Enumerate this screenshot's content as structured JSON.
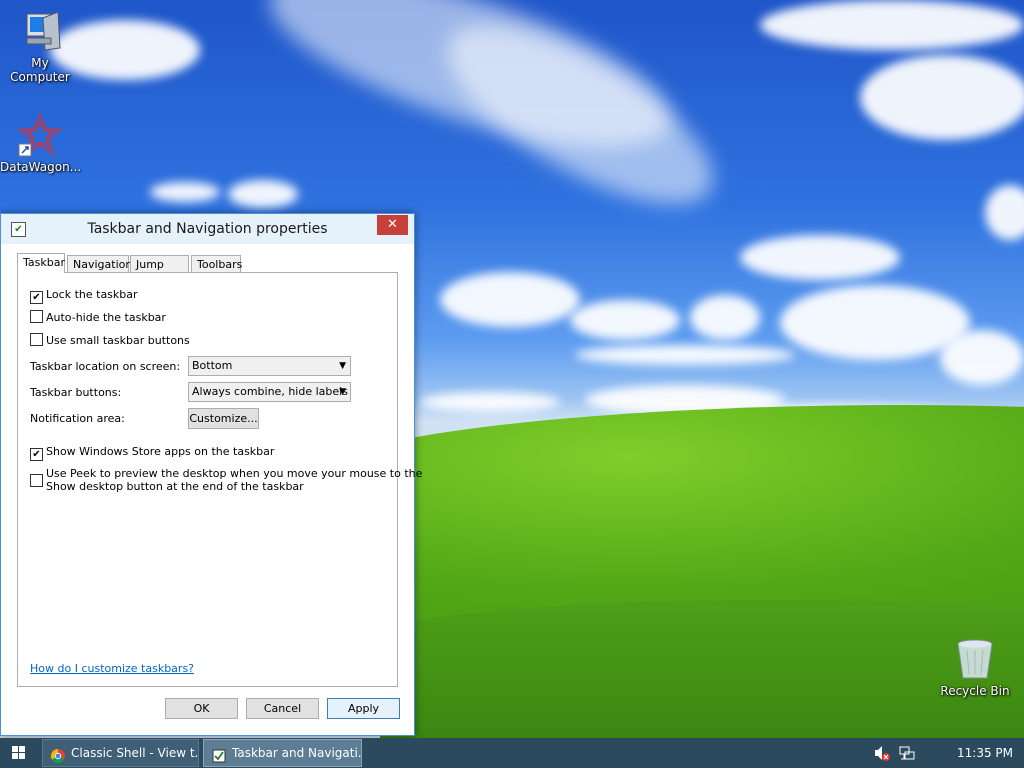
{
  "desktop": {
    "icons": [
      {
        "label": "My Computer",
        "icon": "computer-icon"
      },
      {
        "label": "DataWagon...",
        "icon": "datawagon-icon"
      },
      {
        "label": "Recycle Bin",
        "icon": "recycle-bin-icon"
      }
    ]
  },
  "dialog": {
    "title": "Taskbar and Navigation properties",
    "close_glyph": "✕",
    "tabs": [
      "Taskbar",
      "Navigation",
      "Jump Lists",
      "Toolbars"
    ],
    "active_tab": "Taskbar",
    "options": [
      {
        "label": "Lock the taskbar",
        "checked": true
      },
      {
        "label": "Auto-hide the taskbar",
        "checked": false
      },
      {
        "label": "Use small taskbar buttons",
        "checked": false
      }
    ],
    "location_label": "Taskbar location on screen:",
    "location_value": "Bottom",
    "buttons_label": "Taskbar buttons:",
    "buttons_value": "Always combine, hide labels",
    "notification_label": "Notification area:",
    "customize_label": "Customize...",
    "store_apps": {
      "label": "Show Windows Store apps on the taskbar",
      "checked": true
    },
    "peek": {
      "line1": "Use Peek to preview the desktop when you move your mouse to the",
      "line2": "Show desktop button at the end of the taskbar",
      "checked": false
    },
    "help_link": "How do I customize taskbars?",
    "ok_label": "OK",
    "cancel_label": "Cancel",
    "apply_label": "Apply",
    "check_glyph": "✔",
    "combo_arrow": "▼"
  },
  "taskbar": {
    "items": [
      {
        "label": "Classic Shell - View t...",
        "icon": "chrome-icon"
      },
      {
        "label": "Taskbar and Navigati...",
        "icon": "taskbar-properties-icon"
      }
    ],
    "clock": "11:35 PM"
  },
  "colors": {
    "accent": "#4a90d9",
    "close": "#c7403a",
    "taskbar": "#2c4a5e",
    "link": "#0066cc"
  }
}
